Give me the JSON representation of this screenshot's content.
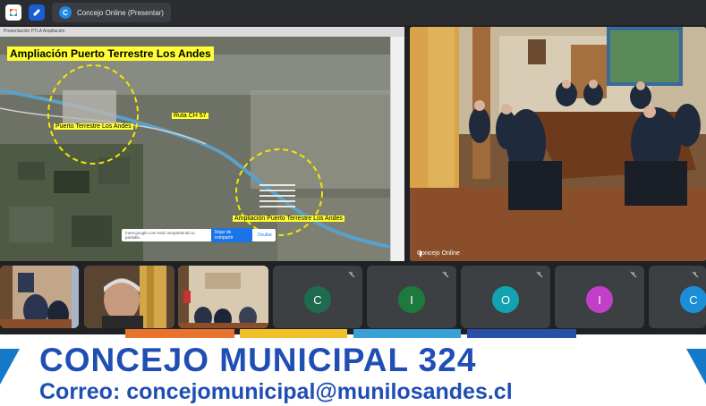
{
  "topbar": {
    "tab_badge": "C",
    "tab_title": "Concejo Online (Presentar)"
  },
  "share": {
    "header_text": "Presentación PTLA Ampliación",
    "map_title": "Ampliación Puerto Terrestre Los Andes",
    "labels": {
      "puerto": "Puerto Terrestre Los Andes",
      "ruta": "Ruta CH 57",
      "ampliacion": "Ampliación Puerto Terrestre Los Andes"
    },
    "toast": {
      "message": "meet.google.com está compartiendo tu pantalla.",
      "stop_label": "Dejar de compartir",
      "hide_label": "Ocultar"
    }
  },
  "camera": {
    "name": "Concejo Online"
  },
  "participants": [
    {
      "initial": "C",
      "color": "#1e6b4f"
    },
    {
      "initial": "I",
      "color": "#1e7a3c"
    },
    {
      "initial": "O",
      "color": "#11a3b0"
    },
    {
      "initial": "I",
      "color": "#c23fc7"
    },
    {
      "initial": "C",
      "color": "#1a8fd8"
    }
  ],
  "banner": {
    "title": "CONCEJO MUNICIPAL 324",
    "email": "Correo: concejomunicipal@munilosandes.cl",
    "stripe_colors": [
      "#e8732c",
      "#f2c12a",
      "#3aa0d8",
      "#2a4fa8"
    ]
  }
}
